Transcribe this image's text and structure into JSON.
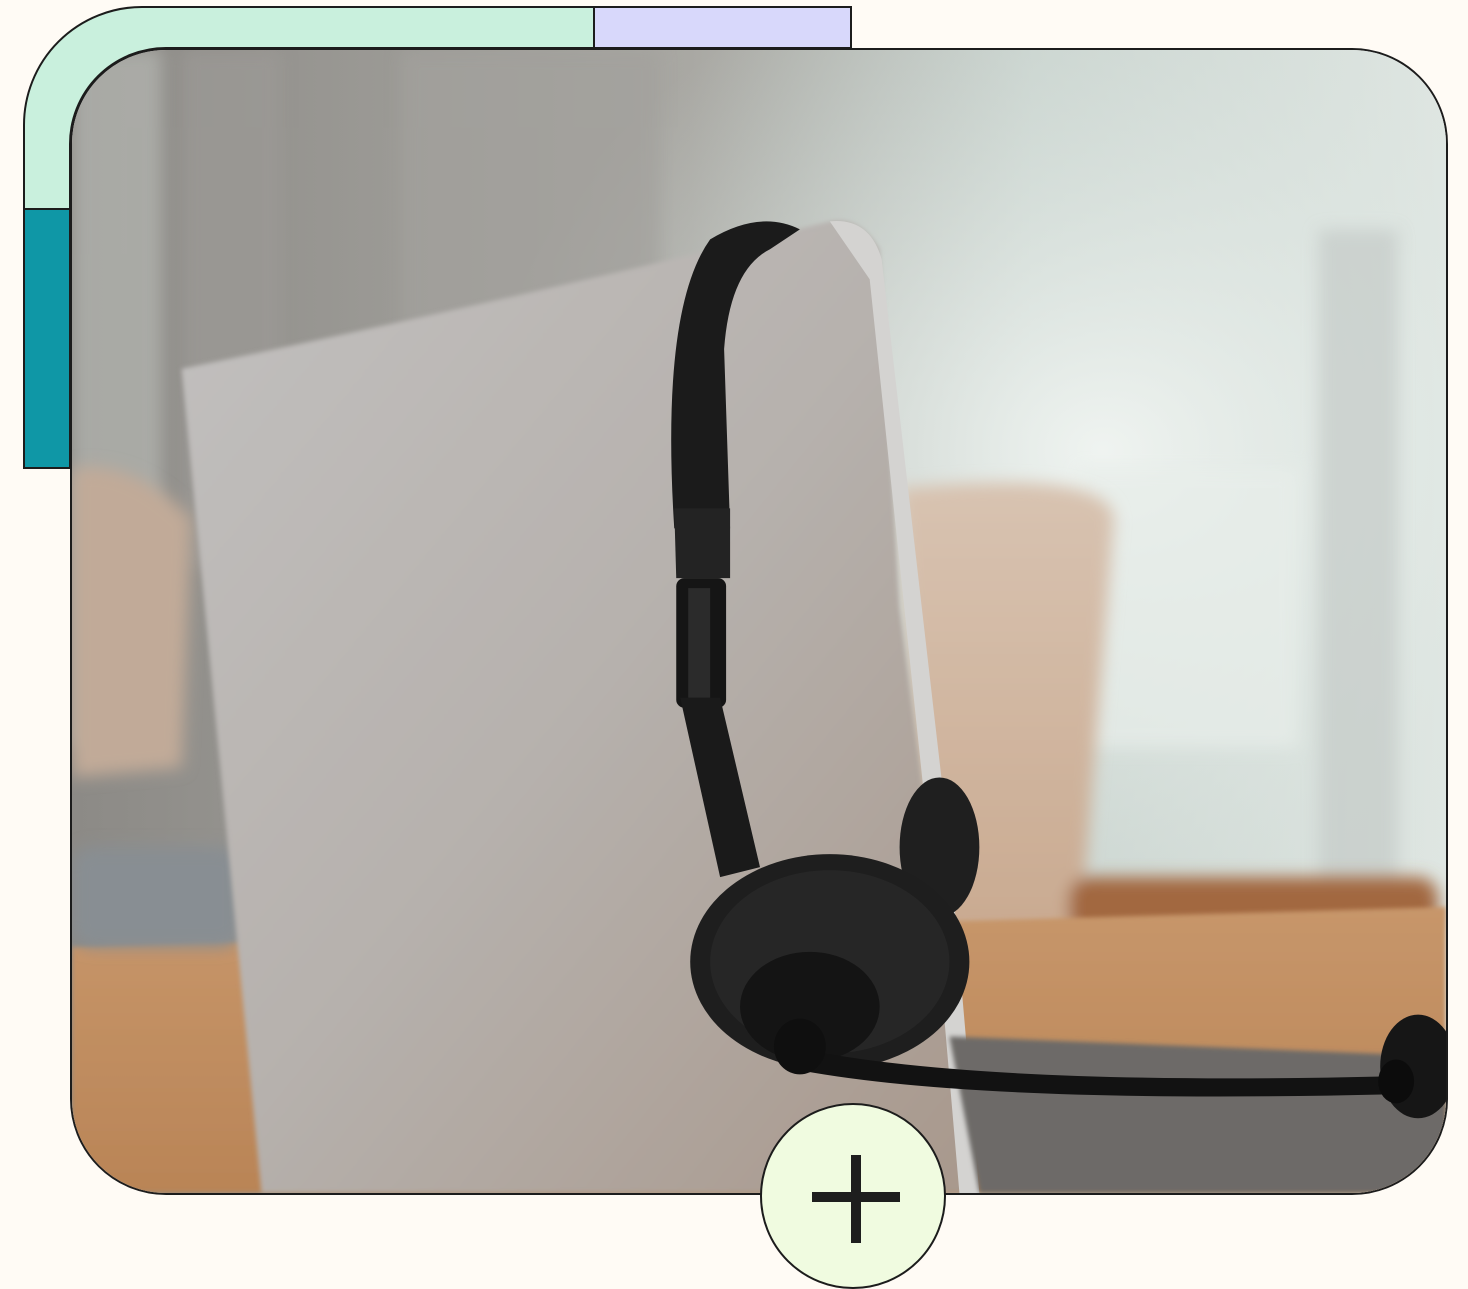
{
  "colors": {
    "page_background": "#fffbf5",
    "accent_mint": "#c9f0dd",
    "accent_lavender": "#d8d8fb",
    "accent_teal": "#0f97a6",
    "outline": "#1c1c1c",
    "button_fill": "#f0fbe0",
    "icon_color": "#1e1e1e"
  },
  "photo": {
    "subject": "laptop-with-headset",
    "icon": "headset-icon"
  },
  "add_button": {
    "icon": "plus-icon"
  }
}
